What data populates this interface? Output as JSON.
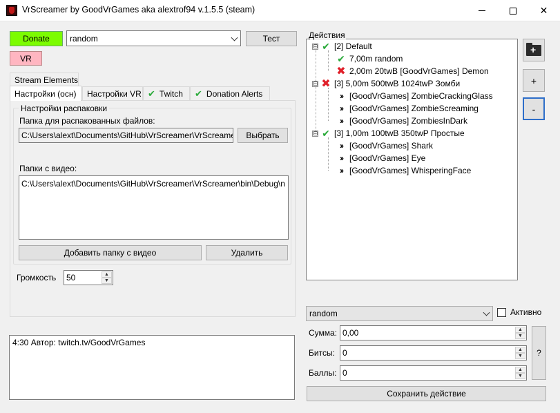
{
  "window": {
    "title": "VrScreamer by GoodVrGames aka alextrof94 v.1.5.5 (steam)",
    "minimize_glyph": "",
    "close_glyph": "✕"
  },
  "top": {
    "donate_label": "Donate",
    "vr_label": "VR",
    "combo_value": "random",
    "test_label": "Тест"
  },
  "tabs": {
    "stream_elements": "Stream Elements",
    "settings_main": "Настройки (осн)",
    "settings_vr": "Настройки VR",
    "twitch": "Twitch",
    "donation_alerts": "Donation Alerts"
  },
  "unpack": {
    "group_title": "Настройки распаковки",
    "folder_label": "Папка для распакованных файлов:",
    "folder_value": "C:\\Users\\alext\\Documents\\GitHub\\VrScreamer\\VrScreamer",
    "choose_label": "Выбрать",
    "video_label": "Папки с видео:",
    "video_value": "C:\\Users\\alext\\Documents\\GitHub\\VrScreamer\\VrScreamer\\bin\\Debug\\n",
    "add_folder_label": "Добавить папку с видео",
    "delete_label": "Удалить"
  },
  "volume": {
    "label": "Громкость",
    "value": "50"
  },
  "log": {
    "text": "4:30 Автор: twitch.tv/GoodVrGames"
  },
  "actions": {
    "label": "Действия",
    "tree": [
      {
        "text": "[2] Default",
        "icon": "check",
        "expander": "⊟"
      },
      {
        "text": "7,00m random",
        "icon": "check"
      },
      {
        "text": "2,00m 20twB [GoodVrGames] Demon",
        "icon": "cross"
      },
      {
        "text": "[3] 5,00m 500twB 1024twP Зомби",
        "icon": "cross",
        "expander": "⊟"
      },
      {
        "text": "[GoodVrGames] ZombieCrackingGlass",
        "icon": "arrows"
      },
      {
        "text": "[GoodVrGames] ZombieScreaming",
        "icon": "arrows"
      },
      {
        "text": "[GoodVrGames] ZombiesInDark",
        "icon": "arrows"
      },
      {
        "text": "[3] 1,00m 100twB 350twP Простые",
        "icon": "check",
        "expander": "⊟"
      },
      {
        "text": "[GoodVrGames] Shark",
        "icon": "arrows"
      },
      {
        "text": "[GoodVrGames] Eye",
        "icon": "arrows"
      },
      {
        "text": "[GoodVrGames] WhisperingFace",
        "icon": "arrows"
      }
    ],
    "plus_label": "+",
    "minus_label": "-",
    "action_combo_value": "random",
    "active_label": "Активно",
    "sum_label": "Сумма:",
    "sum_value": "0,00",
    "bits_label": "Битсы:",
    "bits_value": "0",
    "points_label": "Баллы:",
    "points_value": "0",
    "help_label": "?",
    "save_label": "Сохранить действие"
  },
  "colors": {
    "donate_bg": "#7cfc00",
    "vr_bg": "#ffb6c1",
    "check": "#2aaa3a",
    "cross": "#e0202a"
  }
}
